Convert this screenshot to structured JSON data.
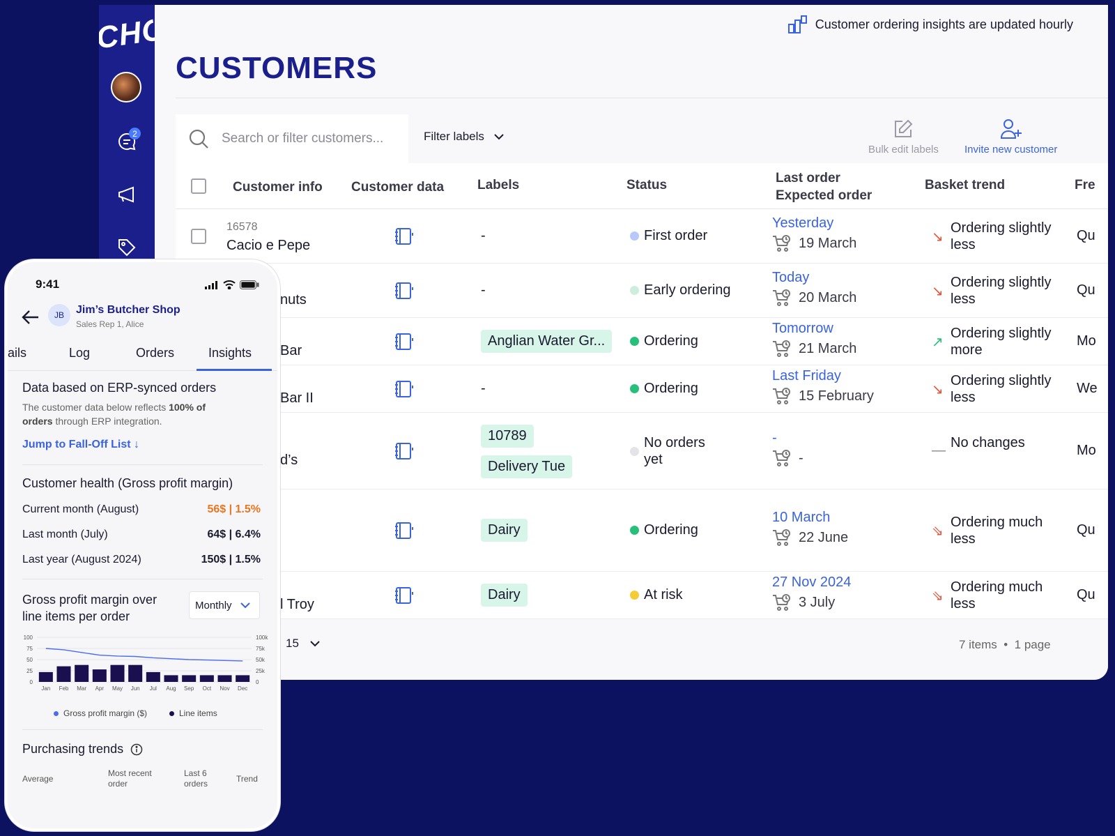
{
  "app": {
    "logo_text": "CHOCO",
    "insights_note": "Customer ordering insights are updated hourly",
    "page_title": "CUSTOMERS",
    "messages_badge": "2"
  },
  "toolbar": {
    "search_placeholder": "Search or filter customers...",
    "filter_labels": "Filter labels",
    "bulk_edit": "Bulk edit labels",
    "invite": "Invite new customer"
  },
  "table": {
    "headers": {
      "customer_info": "Customer info",
      "customer_data": "Customer data",
      "labels": "Labels",
      "status": "Status",
      "last_order": "Last order",
      "expected_order": "Expected order",
      "basket_trend": "Basket trend",
      "frequency": "Fre"
    },
    "rows": [
      {
        "id": "16578",
        "name": "Cacio e Pepe",
        "labels": [
          "-"
        ],
        "status": "First order",
        "status_color": "#b9c8fb",
        "last_order": "Yesterday",
        "expected": "19 March",
        "trend": "Ordering slightly less",
        "trend_color": "#e2553a",
        "trend_symbol": "↘",
        "freq": "Qu"
      },
      {
        "id": "",
        "name": "nuts",
        "labels": [
          "-"
        ],
        "status": "Early ordering",
        "status_color": "#cdeedd",
        "last_order": "Today",
        "expected": "20 March",
        "trend": "Ordering slightly less",
        "trend_color": "#e2553a",
        "trend_symbol": "↘",
        "freq": "Qu"
      },
      {
        "id": "",
        "name": "Bar",
        "labels": [
          "Anglian Water Gr..."
        ],
        "status": "Ordering",
        "status_color": "#27c07a",
        "last_order": "Tomorrow",
        "expected": "21 March",
        "trend": "Ordering slightly more",
        "trend_color": "#27c07a",
        "trend_symbol": "↗",
        "freq": "Mo"
      },
      {
        "id": "",
        "name": "Bar II",
        "labels": [
          "-"
        ],
        "status": "Ordering",
        "status_color": "#27c07a",
        "last_order": "Last Friday",
        "expected": "15 February",
        "trend": "Ordering slightly less",
        "trend_color": "#e2553a",
        "trend_symbol": "↘",
        "freq": "We"
      },
      {
        "id": "",
        "name": "d’s",
        "labels": [
          "10789",
          "Delivery Tue"
        ],
        "status": "No orders yet",
        "status_color": "#e4e4e8",
        "last_order": "-",
        "expected": "-",
        "trend": "No changes",
        "trend_color": "#888888",
        "trend_symbol": "—",
        "freq": "Mo"
      },
      {
        "id": "",
        "name": "",
        "labels": [
          "Dairy"
        ],
        "status": "Ordering",
        "status_color": "#27c07a",
        "last_order": "10 March",
        "expected": "22 June",
        "trend": "Ordering much less",
        "trend_color": "#e2553a",
        "trend_symbol": "⇘",
        "freq": "Qu"
      },
      {
        "id": "",
        "name": "l Troy",
        "labels": [
          "Dairy"
        ],
        "status": "At risk",
        "status_color": "#f5cc35",
        "last_order": "27 Nov 2024",
        "expected": "3 July",
        "trend": "Ordering much less",
        "trend_color": "#e2553a",
        "trend_symbol": "⇘",
        "freq": "Qu"
      }
    ],
    "footer": {
      "page_size": "15",
      "summary": "7 items  •  1 page"
    }
  },
  "phone": {
    "time": "9:41",
    "initials": "JB",
    "shop_name": "Jim’s Butcher Shop",
    "shop_sub": "Sales Rep 1, Alice",
    "tabs": [
      "ails",
      "Log",
      "Orders",
      "Insights"
    ],
    "erp_title": "Data based on ERP-synced orders",
    "erp_text_1": "The customer data below reflects ",
    "erp_text_bold": "100% of orders",
    "erp_text_2": " through ERP integration.",
    "jump_link": "Jump to Fall-Off List ↓",
    "health_title": "Customer health (Gross profit margin)",
    "health_rows": [
      {
        "label": "Current month (August)",
        "value": "56$ | 1.5%",
        "color": "#e8761f"
      },
      {
        "label": "Last month (July)",
        "value": "64$ | 6.4%",
        "color": "#1a1a2e"
      },
      {
        "label": "Last year (August 2024)",
        "value": "150$ | 1.5%",
        "color": "#1a1a2e"
      }
    ],
    "gpm_title_1": "Gross profit margin over",
    "gpm_title_2": "line items per order",
    "monthly": "Monthly",
    "purchasing_title": "Purchasing trends",
    "pt_columns": [
      "Average",
      "Most recent order",
      "Last 6 orders",
      "Trend"
    ]
  },
  "chart_data": {
    "type": "bar",
    "categories": [
      "Jan",
      "Feb",
      "Mar",
      "Apr",
      "May",
      "Jun",
      "Jul",
      "Aug",
      "Sep",
      "Oct",
      "Nov",
      "Dec"
    ],
    "series": [
      {
        "name": "Gross profit margin ($)",
        "type": "line",
        "axis": "left",
        "color": "#4a6cf0",
        "values": [
          75,
          72,
          66,
          60,
          58,
          57,
          54,
          52,
          50,
          49,
          48,
          47
        ]
      },
      {
        "name": "Line items",
        "type": "bar",
        "axis": "right",
        "color": "#1a0f4f",
        "values": [
          22000,
          35000,
          38000,
          28000,
          38000,
          38000,
          22000,
          15000,
          15000,
          15000,
          15000,
          15000
        ]
      }
    ],
    "left_ticks": [
      "100",
      "75",
      "50",
      "25",
      "0"
    ],
    "right_ticks": [
      "100k",
      "75k",
      "50k",
      "25k",
      "0"
    ],
    "ylim_left": [
      0,
      100
    ],
    "ylim_right": [
      0,
      100000
    ],
    "legend": "bottom"
  }
}
